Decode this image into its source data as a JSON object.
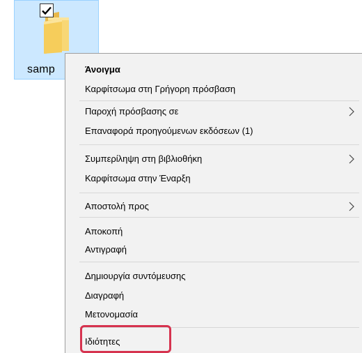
{
  "desktop": {
    "file_label": "samp",
    "file_selected": true,
    "icon": "folder-icon",
    "checkbox_icon": "checkmark-icon"
  },
  "context_menu": {
    "items": [
      {
        "label": "Άνοιγμα",
        "bold": true,
        "submenu": false
      },
      {
        "label": "Καρφίτσωμα στη Γρήγορη πρόσβαση",
        "bold": false,
        "submenu": false
      },
      {
        "label": "Παροχή πρόσβασης σε",
        "bold": false,
        "submenu": true
      },
      {
        "label": "Επαναφορά προηγούμενων εκδόσεων (1)",
        "bold": false,
        "submenu": false
      },
      {
        "label": "Συμπερίληψη στη βιβλιοθήκη",
        "bold": false,
        "submenu": true
      },
      {
        "label": "Καρφίτσωμα στην Έναρξη",
        "bold": false,
        "submenu": false
      },
      {
        "label": "Αποστολή προς",
        "bold": false,
        "submenu": true
      },
      {
        "label": "Αποκοπή",
        "bold": false,
        "submenu": false
      },
      {
        "label": "Αντιγραφή",
        "bold": false,
        "submenu": false
      },
      {
        "label": "Δημιουργία συντόμευσης",
        "bold": false,
        "submenu": false
      },
      {
        "label": "Διαγραφή",
        "bold": false,
        "submenu": false
      },
      {
        "label": "Μετονομασία",
        "bold": false,
        "submenu": false
      },
      {
        "label": "Ιδιότητες",
        "bold": false,
        "submenu": false
      }
    ],
    "chevron_icon": "chevron-right-icon",
    "highlighted_item": "Ιδιότητες"
  },
  "colors": {
    "selection_fill": "#cce8ff",
    "menu_background": "#f2f2f2",
    "highlight_border": "#d6334f",
    "folder_yellow": "#f8d775"
  }
}
